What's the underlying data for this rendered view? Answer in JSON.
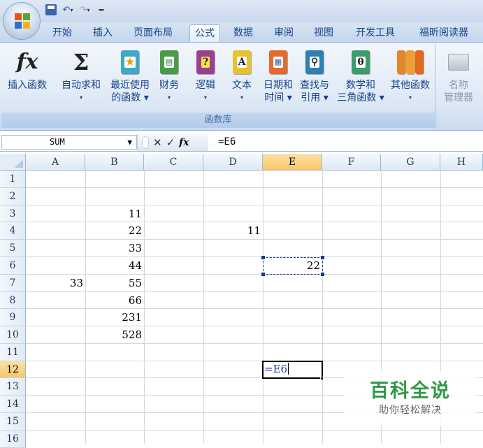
{
  "qat": {
    "save_icon": "save-icon",
    "undo_icon": "undo-icon",
    "redo_icon": "redo-icon",
    "customize_icon": "customize-qat-icon",
    "dropdown_glyph": "▾",
    "customize_glyph": "="
  },
  "tabs": [
    {
      "label": "开始"
    },
    {
      "label": "插入"
    },
    {
      "label": "页面布局"
    },
    {
      "label": "公式",
      "active": true
    },
    {
      "label": "数据"
    },
    {
      "label": "审阅"
    },
    {
      "label": "视图"
    },
    {
      "label": "开发工具"
    },
    {
      "label": "福昕阅读器"
    }
  ],
  "ribbon": {
    "group_label": "函数库",
    "buttons": [
      {
        "line1": "插入函数",
        "line2": "",
        "icon": "fx-icon"
      },
      {
        "line1": "自动求和",
        "line2": "▾",
        "icon": "sigma-icon"
      },
      {
        "line1": "最近使用",
        "line2": "的函数 ▾",
        "icon": "recent-functions-book-icon"
      },
      {
        "line1": "财务",
        "line2": "▾",
        "icon": "financial-book-icon"
      },
      {
        "line1": "逻辑",
        "line2": "▾",
        "icon": "logical-book-icon"
      },
      {
        "line1": "文本",
        "line2": "▾",
        "icon": "text-book-icon"
      },
      {
        "line1": "日期和",
        "line2": "时间 ▾",
        "icon": "date-time-book-icon"
      },
      {
        "line1": "查找与",
        "line2": "引用 ▾",
        "icon": "lookup-reference-book-icon"
      },
      {
        "line1": "数学和",
        "line2": "三角函数 ▾",
        "icon": "math-trig-book-icon"
      },
      {
        "line1": "其他函数",
        "line2": "▾",
        "icon": "more-functions-book-icon"
      }
    ],
    "name_manager": {
      "line1": "名称",
      "line2": "管理器",
      "icon": "name-manager-icon"
    }
  },
  "formula_bar": {
    "name_box": "SUM",
    "name_box_caret": "▼",
    "cancel_glyph": "✕",
    "enter_glyph": "✓",
    "fx_glyph": "fx",
    "formula": "=E6"
  },
  "grid": {
    "columns": [
      "A",
      "B",
      "C",
      "D",
      "E",
      "F",
      "G",
      "H"
    ],
    "selected_column": "E",
    "rows": [
      "1",
      "2",
      "3",
      "4",
      "5",
      "6",
      "7",
      "8",
      "9",
      "10",
      "11",
      "12",
      "13",
      "14",
      "15",
      "16"
    ],
    "selected_row": "12",
    "cells": {
      "B3": "11",
      "B4": "22",
      "D4": "11",
      "B5": "33",
      "B6": "44",
      "E6": "22",
      "A7": "33",
      "B7": "55",
      "B8": "66",
      "B9": "231",
      "B10": "528",
      "E12": "=E6"
    },
    "copy_marquee_cell": "E6",
    "active_cell": "E12"
  },
  "watermark": {
    "title": "百科全说",
    "subtitle": "助你轻松解决"
  },
  "colors": {
    "ribbon_text": "#15428b",
    "selected_header": "#f8c66a",
    "active_cell_text": "#1a3aa0",
    "watermark_green": "#2f9a45"
  }
}
